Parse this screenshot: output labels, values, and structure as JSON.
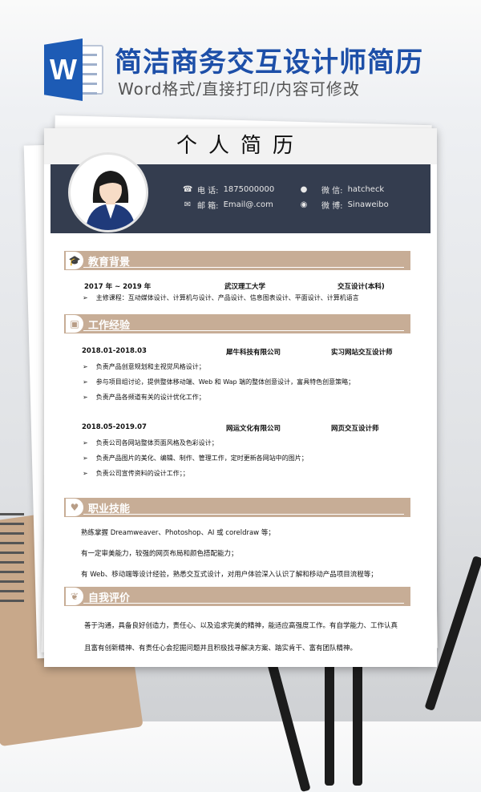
{
  "banner": {
    "title": "简洁商务交互设计师简历",
    "subtitle": "Word格式/直接打印/内容可修改",
    "logo_letter": "W"
  },
  "resume": {
    "title": "个人简历",
    "contact": {
      "phone_label": "电 话:",
      "phone": "1875000000",
      "email_label": "邮 箱:",
      "email": "Email@.com",
      "wechat_label": "微 信:",
      "wechat": "hatcheck",
      "weibo_label": "微 博:",
      "weibo": "Sinaweibo"
    },
    "education": {
      "heading": "教育背景",
      "period": "2017 年 ~ 2019 年",
      "school": "武汉理工大学",
      "major": "交互设计(本科)",
      "courses": "主修课程：互动媒体设计、计算机与设计、产品设计、信息图表设计、平面设计、计算机语言"
    },
    "work": {
      "heading": "工作经验",
      "jobs": [
        {
          "period": "2018.01-2018.03",
          "company": "犀牛科技有限公司",
          "role": "实习网站交互设计师",
          "duties": [
            "负责产品创意规划和主视觉风格设计；",
            "参与项目组讨论，提供整体移动端、Web 和 Wap 端的整体创意设计，富具特色创意策略；",
            "负责产品各频道有关的设计优化工作；"
          ]
        },
        {
          "period": "2018.05-2019.07",
          "company": "网运文化有限公司",
          "role": "网页交互设计师",
          "duties": [
            "负责公司各网站整体页面风格及色彩设计；",
            "负责产品图片的美化、编辑、制作、管理工作，定时更新各网站中的图片；",
            "负责公司宣传资料的设计工作；；"
          ]
        }
      ]
    },
    "skills": {
      "heading": "职业技能",
      "items": [
        "熟练掌握 Dreamweaver、Photoshop、AI 或 coreldraw 等；",
        "有一定审美能力，较强的网页布局和颜色搭配能力；",
        "有 Web、移动端等设计经验，熟悉交互式设计，对用户体验深入认识了解和移动产品项目流程等；"
      ]
    },
    "self": {
      "heading": "自我评价",
      "lines": [
        "善于沟通，具备良好创造力，责任心、以及追求完美的精神，能适应高强度工作。有自学能力、工作认真",
        "且富有创新精神、有责任心会挖掘问题并且积极找寻解决方案、踏实肯干、富有团队精神。"
      ]
    }
  },
  "colors": {
    "accent": "#c7ad96",
    "band": "#343d4f",
    "title": "#1d4fa8"
  }
}
